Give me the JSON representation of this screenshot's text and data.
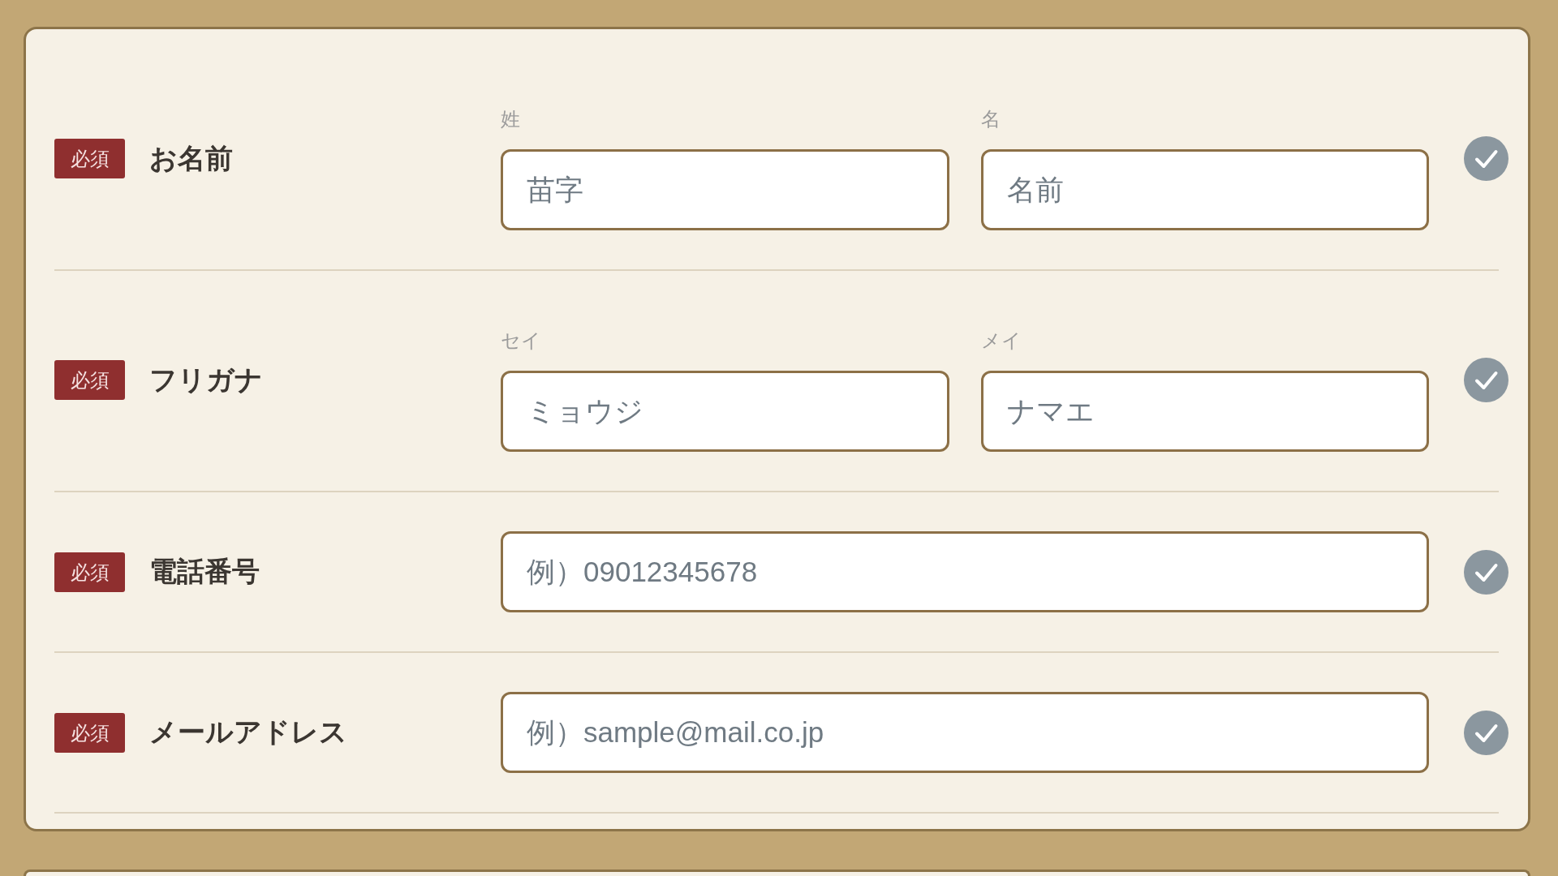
{
  "form": {
    "rows": [
      {
        "kind": "split",
        "badge": "必須",
        "label": "お名前",
        "valid": false,
        "fields": [
          {
            "caption": "姓",
            "placeholder": "苗字"
          },
          {
            "caption": "名",
            "placeholder": "名前"
          }
        ]
      },
      {
        "kind": "split",
        "badge": "必須",
        "label": "フリガナ",
        "valid": false,
        "fields": [
          {
            "caption": "セイ",
            "placeholder": "ミョウジ"
          },
          {
            "caption": "メイ",
            "placeholder": "ナマエ"
          }
        ]
      },
      {
        "kind": "single",
        "badge": "必須",
        "label": "電話番号",
        "valid": false,
        "fields": [
          {
            "placeholder": "例）09012345678"
          }
        ]
      },
      {
        "kind": "single",
        "badge": "必須",
        "label": "メールアドレス",
        "valid": false,
        "fields": [
          {
            "placeholder": "例）sample@mail.co.jp"
          }
        ]
      }
    ]
  }
}
